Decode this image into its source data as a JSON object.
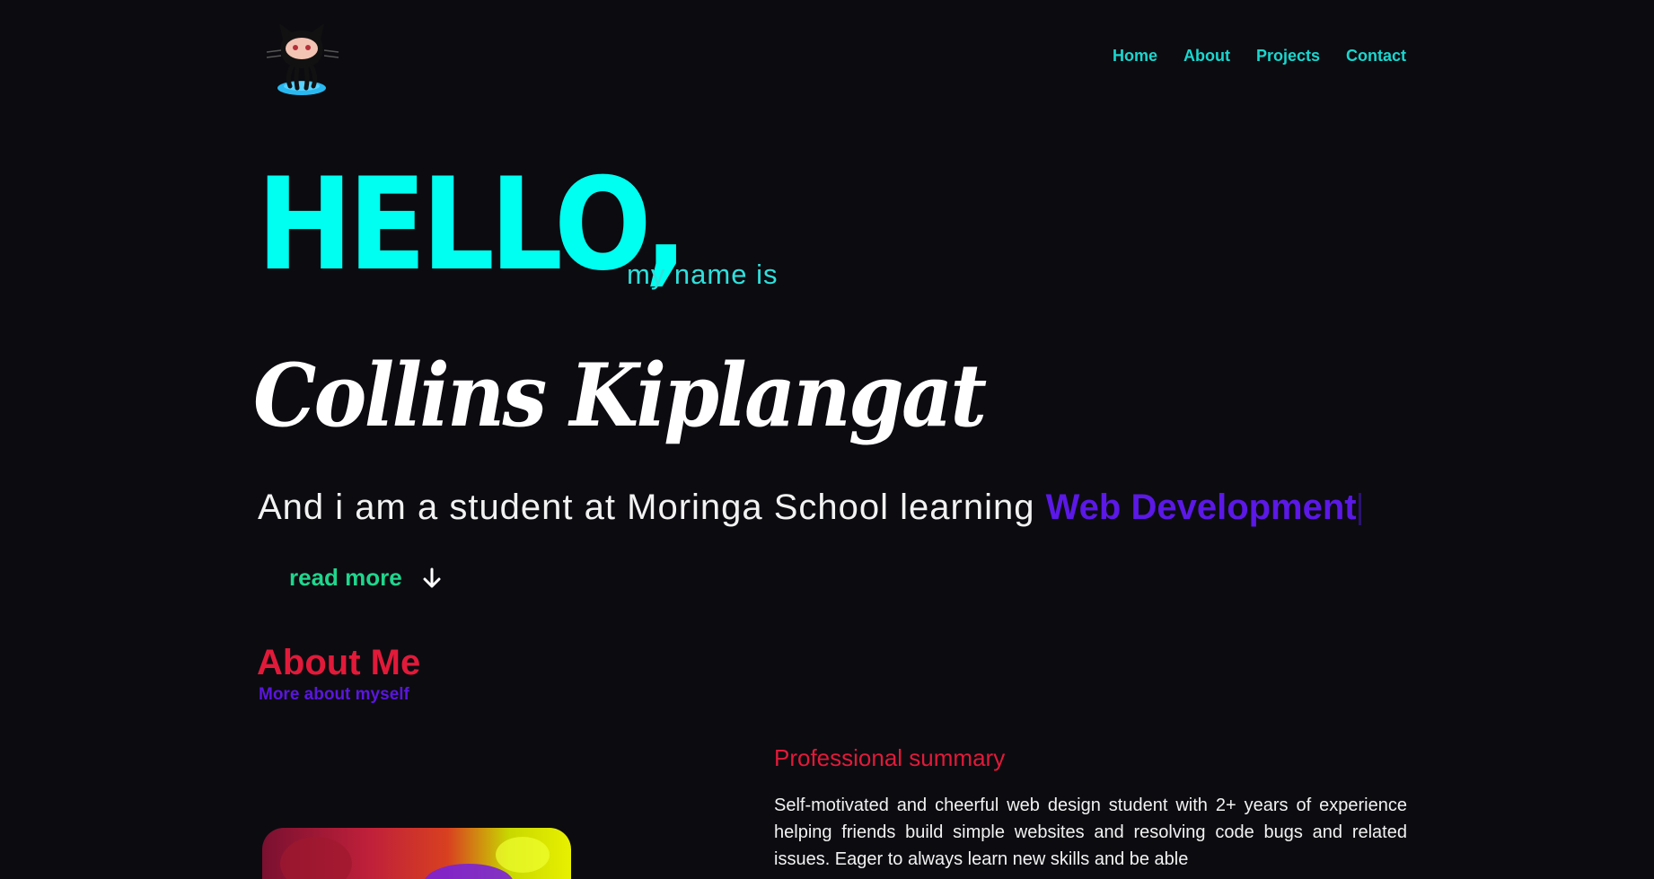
{
  "header": {
    "logo_icon": "octocat-logo-icon",
    "nav": {
      "home": "Home",
      "about": "About",
      "projects": "Projects",
      "contact": "Contact"
    }
  },
  "hero": {
    "greeting": "HELLO,",
    "intro": "my name is",
    "name": "Collins Kiplangat",
    "tagline_prefix": "And i am a student at Moringa School learning",
    "tagline_accent": "Web Development",
    "read_more": "read more",
    "read_more_icon": "arrow-down-icon"
  },
  "about": {
    "title": "About Me",
    "subtitle": "More about myself",
    "summary_title": "Professional summary",
    "summary_text": "Self-motivated and cheerful web design student with 2+ years of experience helping friends build simple websites and resolving code bugs and related issues. Eager to always learn new skills and be able"
  },
  "colors": {
    "background": "#0c0b10",
    "nav_link": "#19d7cf",
    "hello": "#00fff0",
    "accent_purple": "#5b18e6",
    "read_more": "#1fd68d",
    "about_red": "#e11a3a"
  }
}
